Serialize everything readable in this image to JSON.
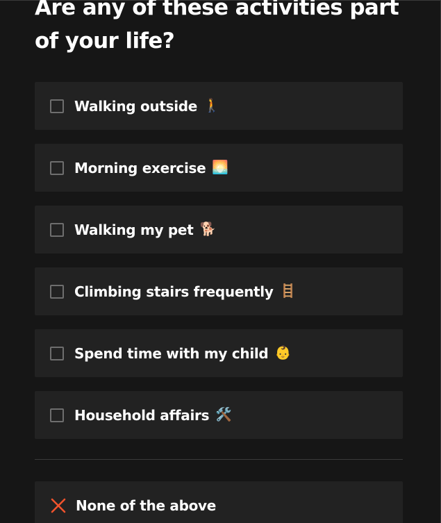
{
  "question": {
    "title": "Are any of these activities part of your life?"
  },
  "options": [
    {
      "label": "Walking outside",
      "emoji": "🚶",
      "icon": "person-walking-icon",
      "checked": false
    },
    {
      "label": "Morning exercise",
      "emoji": "🌅",
      "icon": "sunrise-icon",
      "checked": false
    },
    {
      "label": "Walking my pet",
      "emoji": "🐕",
      "icon": "dog-icon",
      "checked": false
    },
    {
      "label": "Climbing stairs frequently",
      "emoji": "🪜",
      "icon": "ladder-icon",
      "checked": false
    },
    {
      "label": "Spend time with my child",
      "emoji": "👶",
      "icon": "baby-icon",
      "checked": false
    },
    {
      "label": "Household affairs",
      "emoji": "🛠️",
      "icon": "tools-icon",
      "checked": false
    }
  ],
  "none_option": {
    "label": "None of the above",
    "icon": "cross-icon",
    "icon_color": "#f0532d"
  },
  "colors": {
    "background": "#161616",
    "card": "#222222",
    "checkbox_border": "#6e6e6e",
    "divider": "#3a3a3a",
    "text": "#ffffff"
  }
}
